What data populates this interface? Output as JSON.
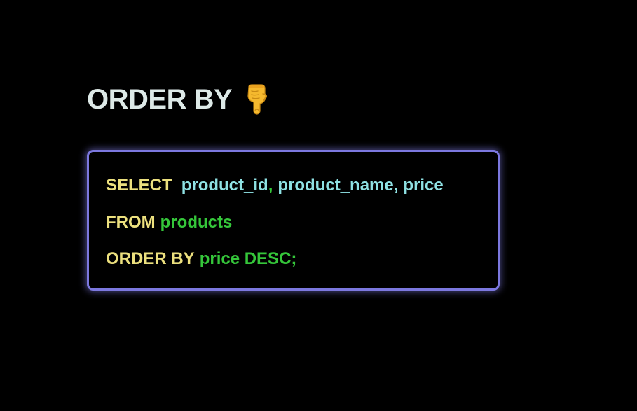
{
  "heading": {
    "text": "ORDER BY",
    "icon": "pointing-down-hand-icon"
  },
  "code": {
    "line1": {
      "keyword": "SELECT",
      "col1": "product_id",
      "sep1": ",",
      "col2": "product_name,",
      "col3": "price"
    },
    "line2": {
      "keyword": "FROM",
      "table": "products"
    },
    "line3": {
      "keyword": "ORDER BY",
      "expr": "price DESC;"
    }
  },
  "colors": {
    "background": "#000000",
    "heading": "#dde9e7",
    "keyword": "#ece07e",
    "column": "#8fe2e4",
    "table": "#35c63a",
    "box_border": "#7c78df"
  }
}
